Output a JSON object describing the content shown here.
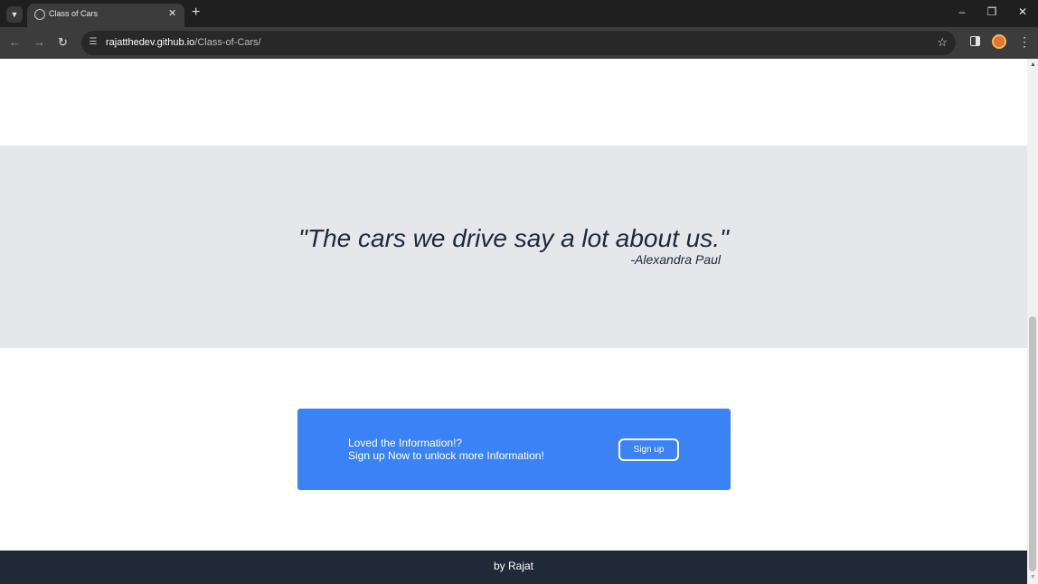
{
  "browser": {
    "tab_title": "Class of Cars",
    "url_host": "rajatthedev.github.io",
    "url_path": "/Class-of-Cars/",
    "icons": [
      "tab-search-icon",
      "globe-icon",
      "close-icon",
      "plus-icon",
      "minimize-icon",
      "restore-icon",
      "close-window-icon",
      "back-icon",
      "forward-icon",
      "reload-icon",
      "site-info-icon",
      "star-icon",
      "side-panel-icon",
      "profile-avatar",
      "menu-icon"
    ]
  },
  "quote": {
    "text": "\"The cars we drive say a lot about us.\"",
    "author": "-Alexandra Paul"
  },
  "cta": {
    "line1": "Loved the Information!?",
    "line2": "Sign up Now to unlock more Information!",
    "button_label": "Sign up"
  },
  "footer": {
    "text": "by Rajat"
  },
  "colors": {
    "quote_band": "#e5e7eb",
    "cta_background": "#3b82f6",
    "footer_background": "#1f2937"
  }
}
